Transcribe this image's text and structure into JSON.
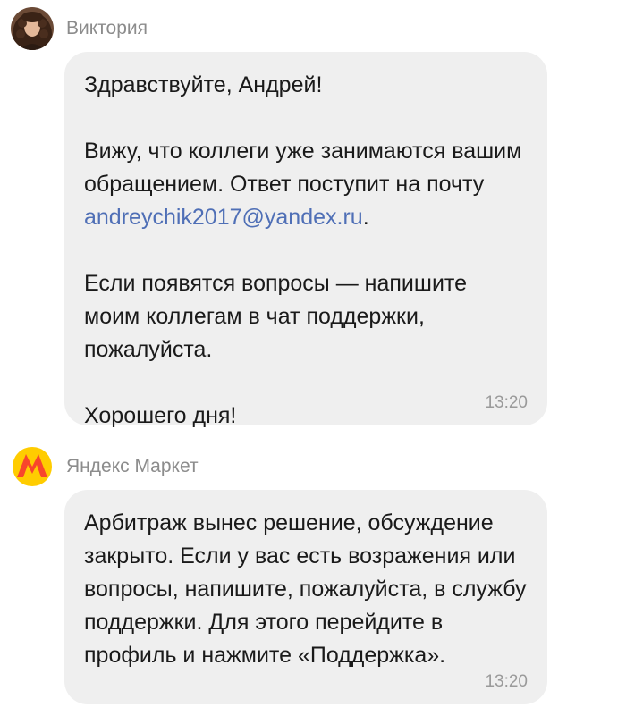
{
  "messages": [
    {
      "sender": "Виктория",
      "avatar_icon": "woman-portrait-icon",
      "greeting": "Здравствуйте, Андрей!",
      "paragraph2_before_link": "Вижу, что коллеги уже занимаются вашим обращением. Ответ поступит на почту ",
      "email_link": "andreychik2017@yandex.ru",
      "paragraph2_after_link": ".",
      "paragraph3": "Если появятся вопросы — напишите моим коллегам в чат поддержки, пожалуйста.",
      "closing": "Хорошего дня!",
      "time": "13:20"
    },
    {
      "sender": "Яндекс Маркет",
      "avatar_icon": "yandex-market-logo-icon",
      "text": "Арбитраж вынес решение, обсуждение закрыто. Если у вас есть возражения или вопросы, напишите, пожалуйста, в службу поддержки. Для этого перейдите в профиль и нажмите «Поддержка».",
      "time": "13:20"
    }
  ],
  "colors": {
    "bubble_bg": "#efefef",
    "link": "#4f6fb6",
    "sender_name": "#8c8c8c",
    "market_logo_bg": "#ffcc00",
    "market_logo_letter": "#f8462c"
  }
}
